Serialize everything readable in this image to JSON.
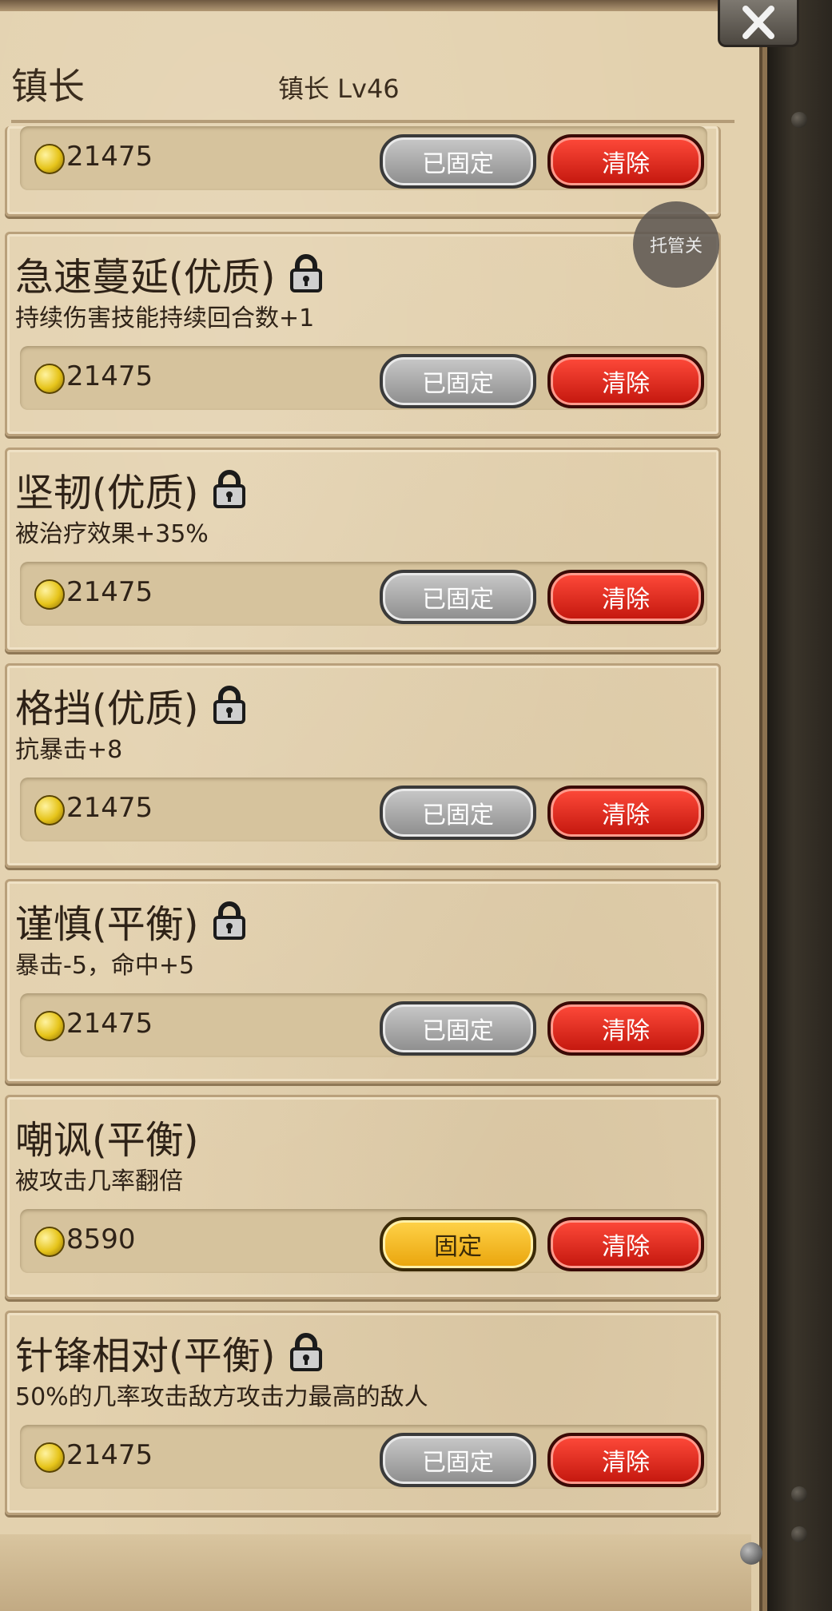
{
  "header": {
    "title": "镇长",
    "subtitle": "镇长 Lv46"
  },
  "float_button": {
    "label": "托管关"
  },
  "top_row": {
    "cost": "21475",
    "fixed_label": "已固定",
    "clear_label": "清除"
  },
  "cards": [
    {
      "title": "急速蔓延(优质)",
      "locked": true,
      "desc": "持续伤害技能持续回合数+1",
      "cost": "21475",
      "fix_label": "已固定",
      "fixed": true,
      "clear_label": "清除"
    },
    {
      "title": "坚韧(优质)",
      "locked": true,
      "desc": "被治疗效果+35%",
      "cost": "21475",
      "fix_label": "已固定",
      "fixed": true,
      "clear_label": "清除"
    },
    {
      "title": "格挡(优质)",
      "locked": true,
      "desc": "抗暴击+8",
      "cost": "21475",
      "fix_label": "已固定",
      "fixed": true,
      "clear_label": "清除"
    },
    {
      "title": "谨慎(平衡)",
      "locked": true,
      "desc": "暴击-5，命中+5",
      "cost": "21475",
      "fix_label": "已固定",
      "fixed": true,
      "clear_label": "清除"
    },
    {
      "title": "嘲讽(平衡)",
      "locked": false,
      "desc": "被攻击几率翻倍",
      "cost": "8590",
      "fix_label": "固定",
      "fixed": false,
      "clear_label": "清除"
    },
    {
      "title": "针锋相对(平衡)",
      "locked": true,
      "desc": "50%的几率攻击敌方攻击力最高的敌人",
      "cost": "21475",
      "fix_label": "已固定",
      "fixed": true,
      "clear_label": "清除"
    }
  ],
  "icons": {
    "close": "close-icon",
    "lock": "lock-icon",
    "coin": "coin-icon"
  }
}
